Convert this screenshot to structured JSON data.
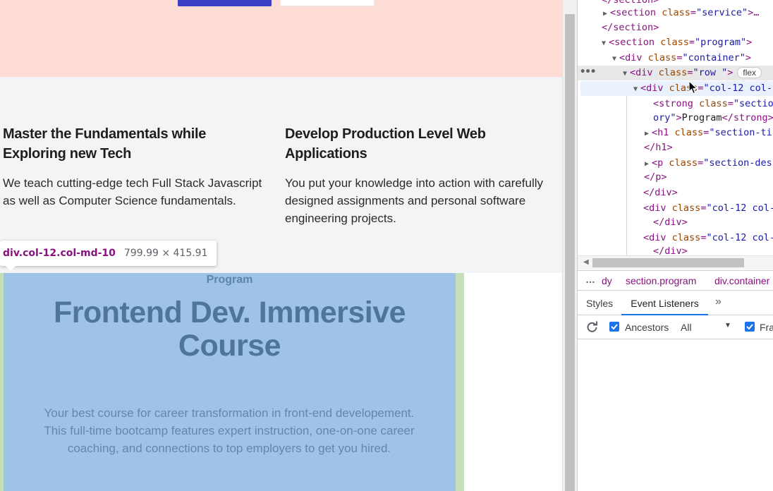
{
  "page": {
    "features": [
      {
        "title": "Master the Fundamentals while Exploring new Tech",
        "desc": "We teach cutting-edge tech Full Stack Javascript as well as Computer Science fundamentals."
      },
      {
        "title": "Develop Production Level Web Applications",
        "desc": "You put your knowledge into action with carefully designed assignments and personal software engineering projects."
      }
    ],
    "program_label": "Program",
    "course_title": "Frontend Dev. Immersive Course",
    "course_desc": "Your best course for career transformation in front-end developement. This full-time bootcamp features expert instruction, one-on-one career coaching, and connections to top employers to get you hired."
  },
  "tooltip": {
    "tag": "div.col-12.col-md-10",
    "size": "799.99 × 415.91"
  },
  "devtools": {
    "dom": {
      "l0": "</section>",
      "l1": {
        "tag": "section",
        "attr": "class",
        "val": "\"service\"",
        "suffix": ">…"
      },
      "l2": "</section>",
      "l3": {
        "tag": "section",
        "attr": "class",
        "val": "\"program\""
      },
      "l4": {
        "tag": "div",
        "attr": "class",
        "val": "\"container\""
      },
      "l5": {
        "tag": "div",
        "attr": "class",
        "val": "\"row \"",
        "badge": "flex"
      },
      "l6": {
        "tag": "div",
        "attr": "class",
        "val": "\"col-12 col-"
      },
      "l7": {
        "tag": "strong",
        "attr": "class",
        "val": "\"sectio"
      },
      "l8": {
        "val": "ory\"",
        "text": "Program",
        "close": "</strong>"
      },
      "l9": {
        "tag": "h1",
        "attr": "class",
        "val": "\"section-ti"
      },
      "l10": "</h1>",
      "l11": {
        "tag": "p",
        "attr": "class",
        "val": "\"section-des"
      },
      "l12": "</p>",
      "l13": "</div>",
      "l14": {
        "tag": "div",
        "attr": "class",
        "val": "\"col-12 col-"
      },
      "l15": "</div>",
      "l16": {
        "tag": "div",
        "attr": "class",
        "val": "\"col-12 col-"
      },
      "l17": "</div>"
    },
    "breadcrumbs": [
      "dy",
      "section.program",
      "div.container"
    ],
    "tabs": {
      "styles": "Styles",
      "event_listeners": "Event Listeners",
      "more": "»"
    },
    "toolbar": {
      "ancestors": "Ancestors",
      "filter": "All",
      "framework": "Fra"
    }
  }
}
